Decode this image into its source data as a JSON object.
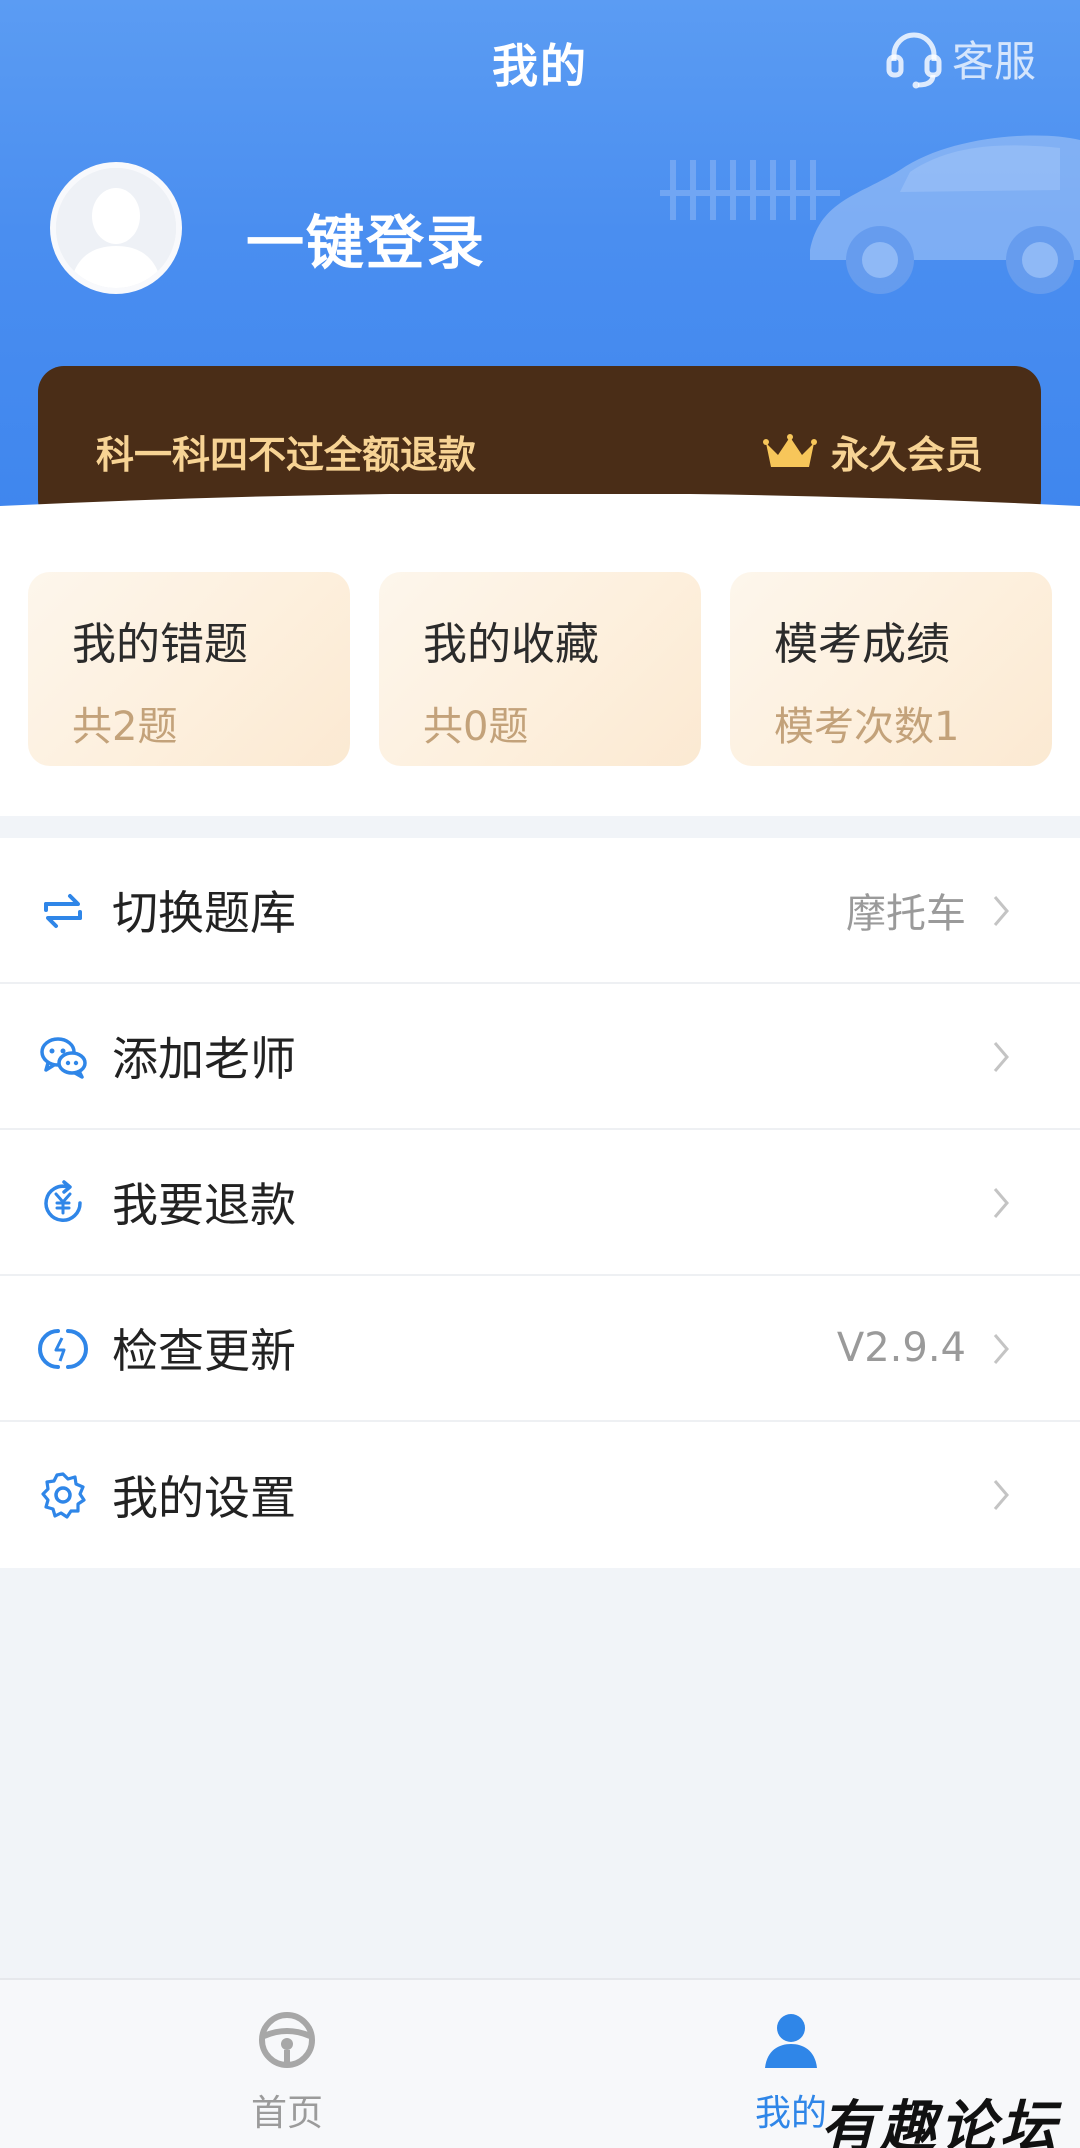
{
  "header": {
    "title": "我的",
    "service_label": "客服",
    "login_label": "一键登录"
  },
  "vip": {
    "promo": "科一科四不过全额退款",
    "member_label": "永久会员"
  },
  "stats": [
    {
      "title": "我的错题",
      "sub": "共2题"
    },
    {
      "title": "我的收藏",
      "sub": "共0题"
    },
    {
      "title": "模考成绩",
      "sub": "模考次数1"
    }
  ],
  "menu": [
    {
      "label": "切换题库",
      "value": "摩托车",
      "icon": "switch-icon"
    },
    {
      "label": "添加老师",
      "value": "",
      "icon": "wechat-icon"
    },
    {
      "label": "我要退款",
      "value": "",
      "icon": "refund-icon"
    },
    {
      "label": "检查更新",
      "value": "V2.9.4",
      "icon": "update-icon"
    },
    {
      "label": "我的设置",
      "value": "",
      "icon": "gear-icon"
    }
  ],
  "tabs": [
    {
      "label": "首页",
      "icon": "steering-wheel-icon",
      "active": false
    },
    {
      "label": "我的",
      "icon": "user-icon",
      "active": true
    }
  ],
  "watermark": "有趣论坛",
  "colors": {
    "header_blue": "#4a8ef0",
    "vip_brown": "#4a2d17",
    "vip_gold": "#f7d394",
    "accent_blue": "#2f86e8"
  }
}
